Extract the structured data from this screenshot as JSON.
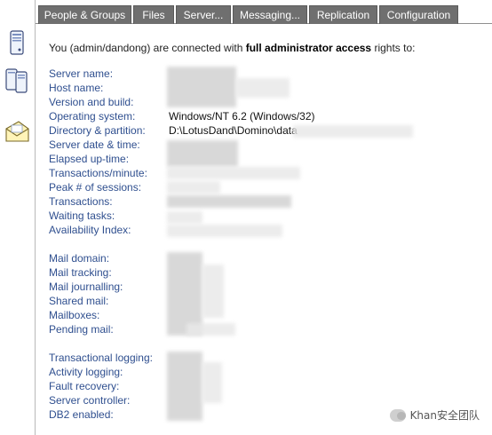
{
  "tabs": [
    {
      "label": "People & Groups"
    },
    {
      "label": "Files"
    },
    {
      "label": "Server..."
    },
    {
      "label": "Messaging..."
    },
    {
      "label": "Replication"
    },
    {
      "label": "Configuration"
    }
  ],
  "rail": {
    "icons": [
      "server-icon",
      "servers-icon",
      "mail-icon"
    ]
  },
  "intro": {
    "prefix": "You (admin/dandong) are connected with ",
    "emphasis": "full administrator access",
    "suffix": " rights to:"
  },
  "server_info": [
    {
      "label": "Server name:",
      "value": ""
    },
    {
      "label": "Host name:",
      "value": ""
    },
    {
      "label": "Version and build:",
      "value": ""
    },
    {
      "label": "Operating system:",
      "value": "Windows/NT 6.2 (Windows/32)"
    },
    {
      "label": "Directory & partition:",
      "value": "D:\\LotusDand\\Domino\\data"
    },
    {
      "label": "Server date & time:",
      "value": ""
    },
    {
      "label": "Elapsed up-time:",
      "value": ""
    },
    {
      "label": "Transactions/minute:",
      "value": ""
    },
    {
      "label": "Peak # of sessions:",
      "value": ""
    },
    {
      "label": "Transactions:",
      "value": ""
    },
    {
      "label": "Waiting tasks:",
      "value": ""
    },
    {
      "label": "Availability Index:",
      "value": ""
    }
  ],
  "mail_info": [
    {
      "label": "Mail domain:",
      "value": ""
    },
    {
      "label": "Mail tracking:",
      "value": ""
    },
    {
      "label": "Mail journalling:",
      "value": ""
    },
    {
      "label": "Shared mail:",
      "value": ""
    },
    {
      "label": "Mailboxes:",
      "value": ""
    },
    {
      "label": "Pending mail:",
      "value": ""
    }
  ],
  "logging_info": [
    {
      "label": "Transactional logging:",
      "value": ""
    },
    {
      "label": "Activity logging:",
      "value": ""
    },
    {
      "label": "Fault recovery:",
      "value": ""
    },
    {
      "label": "Server controller:",
      "value": ""
    },
    {
      "label": "DB2 enabled:",
      "value": ""
    }
  ],
  "watermark": {
    "text": "Khan安全团队"
  }
}
